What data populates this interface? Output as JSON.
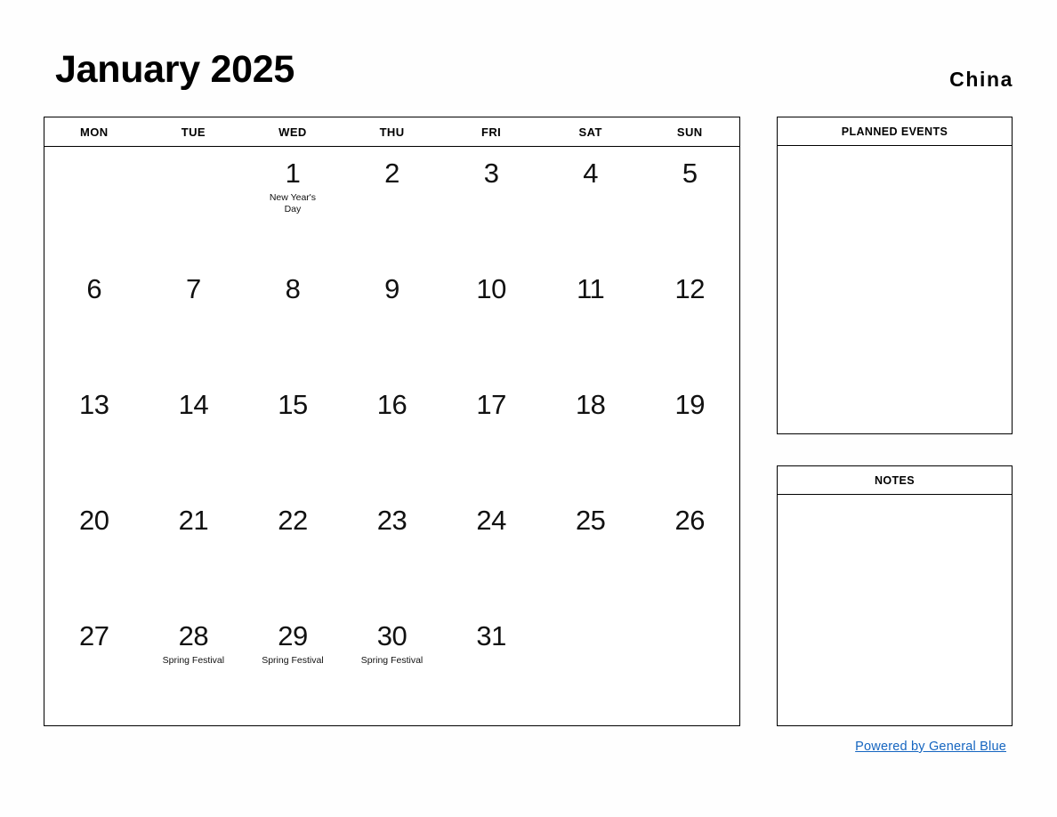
{
  "header": {
    "title": "January 2025",
    "country": "China"
  },
  "calendar": {
    "weekdays": [
      "MON",
      "TUE",
      "WED",
      "THU",
      "FRI",
      "SAT",
      "SUN"
    ],
    "weeks": [
      [
        {
          "day": "",
          "events": []
        },
        {
          "day": "",
          "events": []
        },
        {
          "day": "1",
          "events": [
            "New Year's",
            "Day"
          ]
        },
        {
          "day": "2",
          "events": []
        },
        {
          "day": "3",
          "events": []
        },
        {
          "day": "4",
          "events": []
        },
        {
          "day": "5",
          "events": []
        }
      ],
      [
        {
          "day": "6",
          "events": []
        },
        {
          "day": "7",
          "events": []
        },
        {
          "day": "8",
          "events": []
        },
        {
          "day": "9",
          "events": []
        },
        {
          "day": "10",
          "events": []
        },
        {
          "day": "11",
          "events": []
        },
        {
          "day": "12",
          "events": []
        }
      ],
      [
        {
          "day": "13",
          "events": []
        },
        {
          "day": "14",
          "events": []
        },
        {
          "day": "15",
          "events": []
        },
        {
          "day": "16",
          "events": []
        },
        {
          "day": "17",
          "events": []
        },
        {
          "day": "18",
          "events": []
        },
        {
          "day": "19",
          "events": []
        }
      ],
      [
        {
          "day": "20",
          "events": []
        },
        {
          "day": "21",
          "events": []
        },
        {
          "day": "22",
          "events": []
        },
        {
          "day": "23",
          "events": []
        },
        {
          "day": "24",
          "events": []
        },
        {
          "day": "25",
          "events": []
        },
        {
          "day": "26",
          "events": []
        }
      ],
      [
        {
          "day": "27",
          "events": []
        },
        {
          "day": "28",
          "events": [
            "Spring Festival"
          ]
        },
        {
          "day": "29",
          "events": [
            "Spring Festival"
          ]
        },
        {
          "day": "30",
          "events": [
            "Spring Festival"
          ]
        },
        {
          "day": "31",
          "events": []
        },
        {
          "day": "",
          "events": []
        },
        {
          "day": "",
          "events": []
        }
      ]
    ]
  },
  "panels": [
    {
      "title": "PLANNED EVENTS",
      "content": ""
    },
    {
      "title": "NOTES",
      "content": ""
    }
  ],
  "footer": {
    "link_text": "Powered by General Blue",
    "link_color": "#1565c0"
  }
}
